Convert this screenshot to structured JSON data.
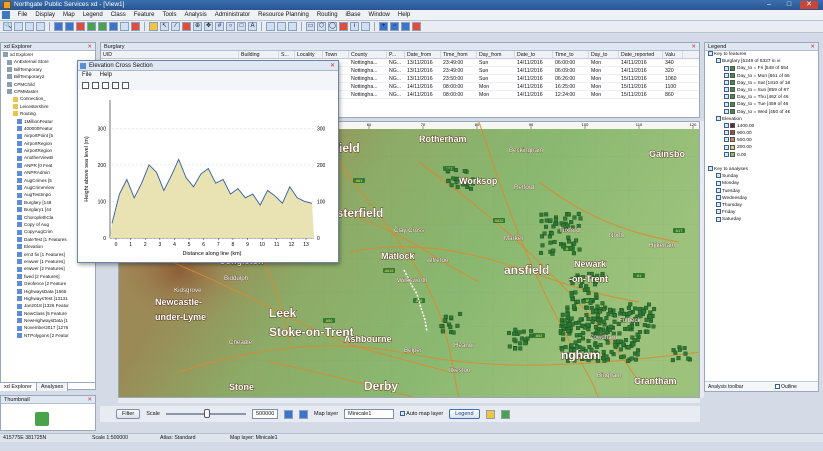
{
  "window": {
    "title": "Northgate Public Services xd - [View1]"
  },
  "menu": [
    "File",
    "Display",
    "Map",
    "Legend",
    "Class",
    "Feature",
    "Tools",
    "Analysis",
    "Administrator",
    "Resource Planning",
    "Routing",
    "iBase",
    "Window",
    "Help"
  ],
  "explorer": {
    "title": "xd Explorer",
    "items": [
      {
        "label": "xd Explorer",
        "kind": "root"
      },
      {
        "label": "AnExternal Store",
        "kind": "db"
      },
      {
        "label": "BillTemporary",
        "kind": "db"
      },
      {
        "label": "BillTemporary2",
        "kind": "db"
      },
      {
        "label": "CPMChild",
        "kind": "db"
      },
      {
        "label": "CPMMaster",
        "kind": "db"
      },
      {
        "label": "Connection_",
        "kind": "folder"
      },
      {
        "label": "Leicestershire",
        "kind": "folder"
      },
      {
        "label": "Routing",
        "kind": "folder"
      },
      {
        "label": "1MillionFeatur",
        "kind": "layer"
      },
      {
        "label": "400000Featur",
        "kind": "layer"
      },
      {
        "label": "AirportPoint [5",
        "kind": "layer"
      },
      {
        "label": "AirportRegion",
        "kind": "layer"
      },
      {
        "label": "AirportRegion",
        "kind": "layer"
      },
      {
        "label": "AnotherViewB",
        "kind": "layer"
      },
      {
        "label": "ANPR [0 Feat",
        "kind": "layer"
      },
      {
        "label": "ANPRAdmin",
        "kind": "layer"
      },
      {
        "label": "AugCrimes [5",
        "kind": "layer"
      },
      {
        "label": "AugCrimeView",
        "kind": "layer"
      },
      {
        "label": "AugTestImpo",
        "kind": "layer"
      },
      {
        "label": "Burglary [148",
        "kind": "layer"
      },
      {
        "label": "Burglary1 [44",
        "kind": "layer"
      },
      {
        "label": "ChoroplethCla",
        "kind": "layer"
      },
      {
        "label": "Copy of Aug",
        "kind": "layer"
      },
      {
        "label": "CopyAugCrim",
        "kind": "layer"
      },
      {
        "label": "DateTest [1 Features",
        "kind": "layer"
      },
      {
        "label": "Elevation",
        "kind": "layer"
      },
      {
        "label": "ern3 fix [1 Features]",
        "kind": "layer"
      },
      {
        "label": "erwwer [1 Features]",
        "kind": "layer"
      },
      {
        "label": "erwwer [2 Features]",
        "kind": "layer"
      },
      {
        "label": "fwed [2 Features]",
        "kind": "layer"
      },
      {
        "label": "Geofence [2 Feature",
        "kind": "layer"
      },
      {
        "label": "HighwaysData [1565",
        "kind": "layer"
      },
      {
        "label": "HighwaysTest [13131",
        "kind": "layer"
      },
      {
        "label": "Jan2018 [1326 Featur",
        "kind": "layer"
      },
      {
        "label": "NewClass [5 Feature",
        "kind": "layer"
      },
      {
        "label": "NewHighwaysData [1",
        "kind": "layer"
      },
      {
        "label": "November2017 [1276",
        "kind": "layer"
      },
      {
        "label": "NTPolygons [2 Featur",
        "kind": "layer"
      }
    ],
    "tabs": [
      "xd Explorer",
      "Analyses"
    ],
    "thumbnail_title": "Thumbnail"
  },
  "table": {
    "title": "Burglary",
    "columns": [
      "UID",
      "Building",
      "S...",
      "Locality",
      "Town",
      "County",
      "P...",
      "Date_from",
      "Time_from",
      "Day_from",
      "Date_to",
      "Time_to",
      "Day_to",
      "Date_reported",
      "Valu"
    ],
    "rows": [
      [
        "",
        "",
        "",
        "",
        "",
        "Nottingha...",
        "NG...",
        "13/11/2016",
        "23:49:00",
        "Sun",
        "14/11/2016",
        "06:00:00",
        "Mon",
        "14/11/2016",
        "340"
      ],
      [
        "",
        "",
        "",
        "",
        "",
        "Nottingha...",
        "NG...",
        "13/11/2016",
        "23:49:00",
        "Sun",
        "14/11/2016",
        "06:09:00",
        "Mon",
        "14/11/2016",
        "320"
      ],
      [
        "",
        "",
        "",
        "",
        "",
        "Nottingha...",
        "NG...",
        "13/11/2016",
        "23:50:00",
        "Sun",
        "14/11/2016",
        "06:26:00",
        "Mon",
        "15/11/2016",
        "1060"
      ],
      [
        "",
        "",
        "",
        "",
        "",
        "Nottingha...",
        "NG...",
        "14/11/2016",
        "08:00:00",
        "Mon",
        "14/11/2016",
        "16:25:00",
        "Mon",
        "15/11/2016",
        "1100"
      ],
      [
        "",
        "",
        "",
        "",
        "",
        "Nottingha...",
        "NG...",
        "14/11/2016",
        "08:00:00",
        "Mon",
        "14/11/2016",
        "12:24:00",
        "Mon",
        "15/11/2016",
        "860"
      ]
    ]
  },
  "cross_section": {
    "title": "Elevation Cross Section",
    "menu": [
      "File",
      "Help"
    ],
    "ylabel": "Height above sea level (m)",
    "xlabel": "Distance along line (km)",
    "y_ticks": [
      "0",
      "100",
      "200",
      "300"
    ],
    "x_ticks": [
      "0",
      "1",
      "2",
      "3",
      "4",
      "5",
      "6",
      "7",
      "8",
      "9",
      "10",
      "11",
      "12",
      "13"
    ]
  },
  "map": {
    "places": [
      {
        "name": "Sheffield",
        "size": "big"
      },
      {
        "name": "Rotherham",
        "size": "mid"
      },
      {
        "name": "Beckingham",
        "size": "small"
      },
      {
        "name": "Gainsbo",
        "size": "mid"
      },
      {
        "name": "Worksop",
        "size": "mid"
      },
      {
        "name": "Retford",
        "size": "small"
      },
      {
        "name": "Chesterfield",
        "size": "big"
      },
      {
        "name": "Market",
        "size": "small"
      },
      {
        "name": "Tuxford",
        "size": "small"
      },
      {
        "name": "North",
        "size": "small"
      },
      {
        "name": "Hykeham",
        "size": "small"
      },
      {
        "name": "Clay Cross",
        "size": "small"
      },
      {
        "name": "Matlock",
        "size": "mid"
      },
      {
        "name": "Alfreton",
        "size": "small"
      },
      {
        "name": "ansfield",
        "size": "big"
      },
      {
        "name": "Newark",
        "size": "mid"
      },
      {
        "name": "-on-Trent",
        "size": "mid"
      },
      {
        "name": "Congleton",
        "size": "mid"
      },
      {
        "name": "Biddulph",
        "size": "small"
      },
      {
        "name": "Leek",
        "size": "big"
      },
      {
        "name": "Kidsgrove",
        "size": "small"
      },
      {
        "name": "Wirksworth",
        "size": "small"
      },
      {
        "name": "Newcastle-",
        "size": "mid"
      },
      {
        "name": "under-Lyme",
        "size": "mid"
      },
      {
        "name": "Stoke-on-Trent",
        "size": "big"
      },
      {
        "name": "Cheadle",
        "size": "small"
      },
      {
        "name": "Ashbourne",
        "size": "mid"
      },
      {
        "name": "Belper",
        "size": "small"
      },
      {
        "name": "Heanor",
        "size": "small"
      },
      {
        "name": "ngham",
        "size": "big"
      },
      {
        "name": "Bingham",
        "size": "small"
      },
      {
        "name": "Fulbeck",
        "size": "small"
      },
      {
        "name": "Grantham",
        "size": "mid"
      },
      {
        "name": "Derby",
        "size": "big"
      },
      {
        "name": "Stone",
        "size": "mid"
      },
      {
        "name": "Ilkeston",
        "size": "small"
      },
      {
        "name": "Cowdham",
        "size": "small"
      }
    ],
    "road_labels": [
      "A6",
      "A38",
      "A50",
      "A52",
      "A60",
      "A61",
      "A57",
      "A1",
      "A17",
      "A46",
      "A515",
      "A619",
      "A632",
      "A615"
    ],
    "ruler_ticks": [
      "60",
      "70",
      "80",
      "90",
      "100",
      "110",
      "120"
    ]
  },
  "legend": {
    "title": "Legend",
    "items": [
      {
        "label": "Key to features",
        "level": 0,
        "swatch": ""
      },
      {
        "label": "Burglary [5249 of 5327 in vi",
        "level": 1,
        "swatch": ""
      },
      {
        "label": "Day_to = Fri [548 of 554",
        "level": 2,
        "swatch": "#3f8f3f"
      },
      {
        "label": "Day_to = Mon [661 of 66",
        "level": 2,
        "swatch": "#3f8f3f"
      },
      {
        "label": "Day_to = Sat [1810 of 18",
        "level": 2,
        "swatch": "#3f8f3f"
      },
      {
        "label": "Day_to = Sun [859 of 87",
        "level": 2,
        "swatch": "#3f8f3f"
      },
      {
        "label": "Day_to = Thu [462 of 46",
        "level": 2,
        "swatch": "#3f8f3f"
      },
      {
        "label": "Day_to = Tue [459 of 46",
        "level": 2,
        "swatch": "#3f8f3f"
      },
      {
        "label": "Day_to = Wed [450 of 4€",
        "level": 2,
        "swatch": "#3f8f3f"
      },
      {
        "label": "Elevation",
        "level": 1,
        "swatch": ""
      },
      {
        "label": "1400.00",
        "level": 2,
        "swatch": "#6b1e3a"
      },
      {
        "label": "900.00",
        "level": 2,
        "swatch": "#a24a3a"
      },
      {
        "label": "500.00",
        "level": 2,
        "swatch": "#c98f54"
      },
      {
        "label": "200.00",
        "level": 2,
        "swatch": "#d9d27a"
      },
      {
        "label": "0.00",
        "level": 2,
        "swatch": "#8fc26a"
      },
      {
        "label": "",
        "level": 0,
        "swatch": ""
      },
      {
        "label": "Key to analyses",
        "level": 0,
        "swatch": ""
      },
      {
        "label": "Sunday",
        "level": 1,
        "swatch": ""
      },
      {
        "label": "Monday",
        "level": 1,
        "swatch": ""
      },
      {
        "label": "Tuesday",
        "level": 1,
        "swatch": ""
      },
      {
        "label": "Wednesday",
        "level": 1,
        "swatch": ""
      },
      {
        "label": "Thursday",
        "level": 1,
        "swatch": ""
      },
      {
        "label": "Friday",
        "level": 1,
        "swatch": ""
      },
      {
        "label": "Saturday",
        "level": 1,
        "swatch": ""
      }
    ],
    "footer": {
      "label": "Analysis toolbar",
      "outline": "Outline"
    }
  },
  "bottombar": {
    "filter": "Filter",
    "scale_label": "Scale",
    "scale_value": "500000",
    "map_layer_label": "Map layer",
    "map_layer_value": "Minicale1",
    "auto_map_layer": "Auto map layer",
    "legend": "Legend"
  },
  "status": {
    "coords": "415775E 381725N",
    "scale": "Scale 1:500000",
    "atlas": "Atlas: Standard",
    "map_layer": "Map layer: Minicale1"
  },
  "colors": {
    "accent": "#3a6fae",
    "feature_green": "#2f7a35",
    "map_green": "#6fa55a",
    "map_brown": "#a5753f"
  }
}
